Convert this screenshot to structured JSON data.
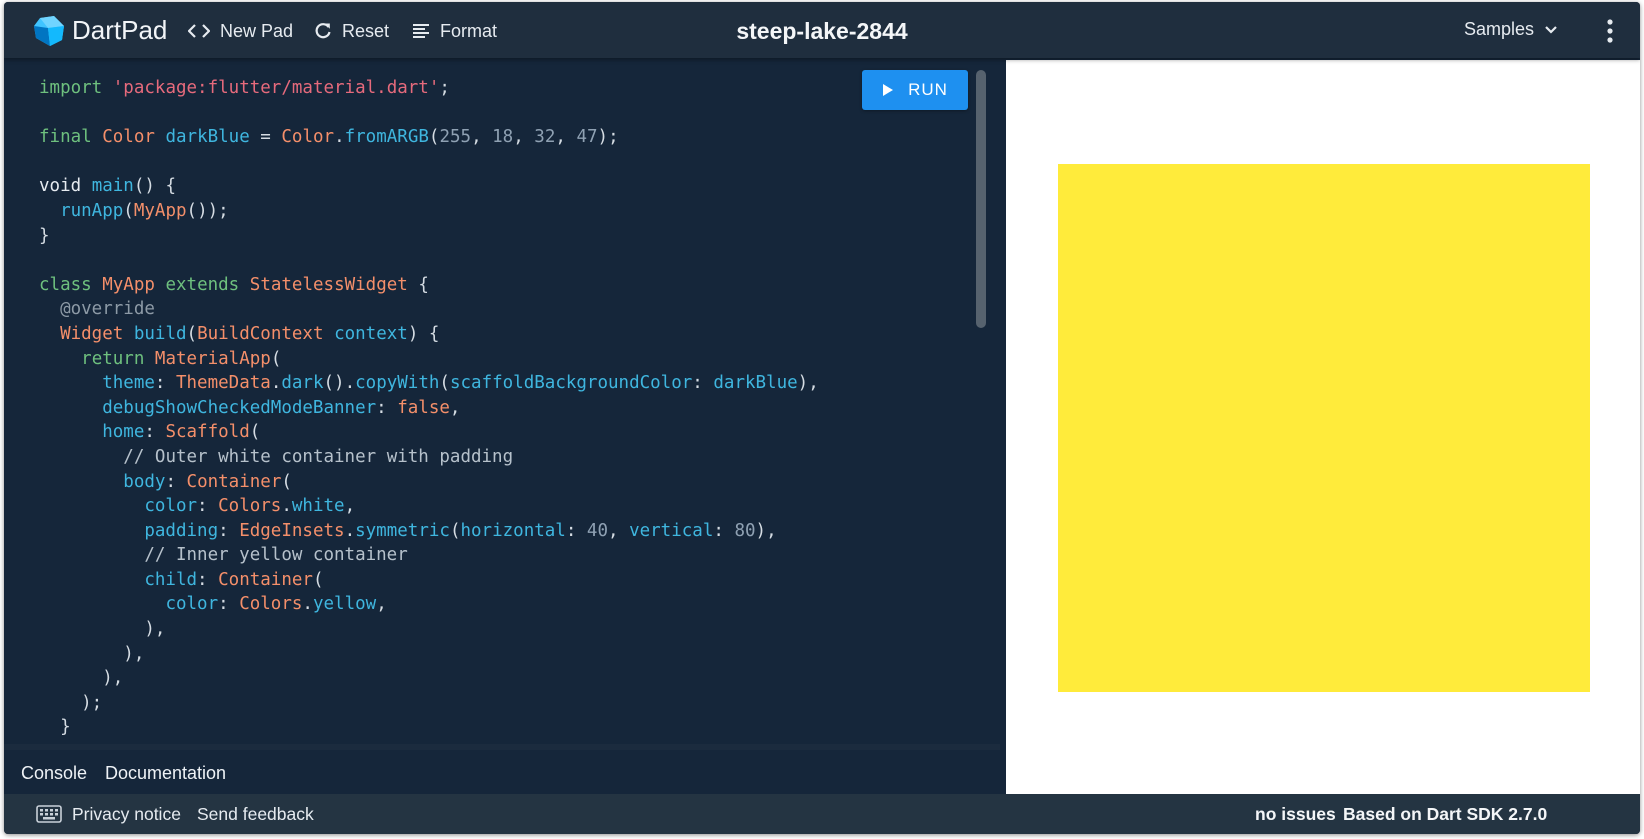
{
  "header": {
    "brand": "DartPad",
    "new_pad": "New Pad",
    "reset": "Reset",
    "format": "Format",
    "pad_name": "steep-lake-2844",
    "samples": "Samples"
  },
  "editor": {
    "run_label": "RUN",
    "code_lines": [
      "import 'package:flutter/material.dart';",
      "",
      "final Color darkBlue = Color.fromARGB(255, 18, 32, 47);",
      "",
      "void main() {",
      "  runApp(MyApp());",
      "}",
      "",
      "class MyApp extends StatelessWidget {",
      "  @override",
      "  Widget build(BuildContext context) {",
      "    return MaterialApp(",
      "      theme: ThemeData.dark().copyWith(scaffoldBackgroundColor: darkBlue),",
      "      debugShowCheckedModeBanner: false,",
      "      home: Scaffold(",
      "        // Outer white container with padding",
      "        body: Container(",
      "          color: Colors.white,",
      "          padding: EdgeInsets.symmetric(horizontal: 40, vertical: 80),",
      "          // Inner yellow container",
      "          child: Container(",
      "            color: Colors.yellow,",
      "          ),",
      "        ),",
      "      ),",
      "    );",
      "  }"
    ]
  },
  "tabs": {
    "console": "Console",
    "documentation": "Documentation"
  },
  "output": {
    "outer_color": "#ffffff",
    "inner_color": "#ffeb3b"
  },
  "footer": {
    "privacy": "Privacy notice",
    "feedback": "Send feedback",
    "issues": "no issues",
    "sdk": "Based on Dart SDK 2.7.0"
  },
  "colors": {
    "header_bg": "#1f2e3e",
    "editor_bg": "#15263a",
    "run_button": "#1e90f0",
    "footer_bg": "#243442"
  }
}
